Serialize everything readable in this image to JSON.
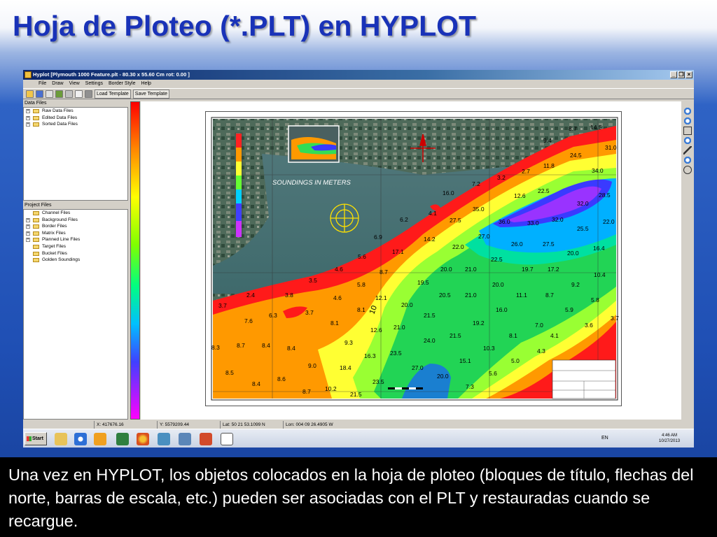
{
  "slide": {
    "title": "Hoja de Ploteo (*.PLT) en HYPLOT",
    "caption": "Una vez en HYPLOT, los objetos colocados en la hoja de ploteo (bloques de título, flechas del norte, barras de escala, etc.) pueden ser asociadas con el PLT y restauradas cuando se recargue."
  },
  "window": {
    "title": "Hyplot [Plymouth 1000 Feature.plt - 80.30 x 55.60 Cm  rot: 0.00 ]",
    "buttons": [
      "_",
      "❐",
      "×"
    ]
  },
  "menu": [
    "File",
    "Draw",
    "View",
    "Settings",
    "Border Style",
    "Help"
  ],
  "toolbar": {
    "load_template": "Load Template",
    "save_template": "Save Template"
  },
  "data_files": {
    "title": "Data Files",
    "items": [
      "Raw Data Files",
      "Edited Data Files",
      "Sorted Data Files"
    ]
  },
  "project_files": {
    "title": "Project Files",
    "items": [
      {
        "label": "Channel Files",
        "expandable": false
      },
      {
        "label": "Background Files",
        "expandable": true
      },
      {
        "label": "Border Files",
        "expandable": true
      },
      {
        "label": "Matrix Files",
        "expandable": true
      },
      {
        "label": "Planned Line Files",
        "expandable": true
      },
      {
        "label": "Target Files",
        "expandable": false
      },
      {
        "label": "Bucket Files",
        "expandable": false
      },
      {
        "label": "Golden Soundings",
        "expandable": false
      }
    ]
  },
  "map": {
    "label": "SOUNDINGS IN METERS",
    "contour_label": "10",
    "soundings": [
      "8.7",
      "14.5",
      "9.4",
      "24.5",
      "31.0",
      "11.8",
      "2.7",
      "34.0",
      "3.2",
      "7.2",
      "22.5",
      "12.6",
      "16.0",
      "28.5",
      "32.0",
      "4.1",
      "35.0",
      "6.2",
      "27.5",
      "36.0",
      "33.0",
      "32.0",
      "22.0",
      "14.2",
      "27.0",
      "25.5",
      "6.9",
      "22.0",
      "26.0",
      "27.5",
      "17.1",
      "5.6",
      "22.5",
      "16.4",
      "20.0",
      "4.6",
      "8.7",
      "20.0",
      "21.0",
      "19.7",
      "17.2",
      "3.5",
      "5.8",
      "19.5",
      "10.4",
      "9.2",
      "2.4",
      "3.8",
      "12.1",
      "4.6",
      "20.5",
      "21.0",
      "20.0",
      "11.1",
      "8.7",
      "3.7",
      "20.0",
      "5.8",
      "8.1",
      "16.0",
      "5.9",
      "6.3",
      "3.7",
      "21.5",
      "7.6",
      "8.1",
      "19.2",
      "7.0",
      "3.6",
      "3.7",
      "21.0",
      "12.6",
      "24.0",
      "21.5",
      "8.1",
      "4.1",
      "8.3",
      "8.7",
      "8.4",
      "8.4",
      "9.3",
      "10.3",
      "16.3",
      "23.5",
      "4.3",
      "9.0",
      "18.4",
      "15.1",
      "5.0",
      "27.0",
      "8.5",
      "20.0",
      "5.6",
      "8.6",
      "8.4",
      "23.5",
      "7.3",
      "10.2",
      "8.7",
      "21.5"
    ]
  },
  "status": {
    "x": "X: 417676.16",
    "y": "Y: 5579209.44",
    "lat": "Lat: 50 21 53.1099 N",
    "lon": "Lon: 004 09 26.4905 W"
  },
  "taskbar": {
    "start": "Start",
    "lang": "EN",
    "time": "4:46 AM",
    "date": "10/27/2013"
  }
}
